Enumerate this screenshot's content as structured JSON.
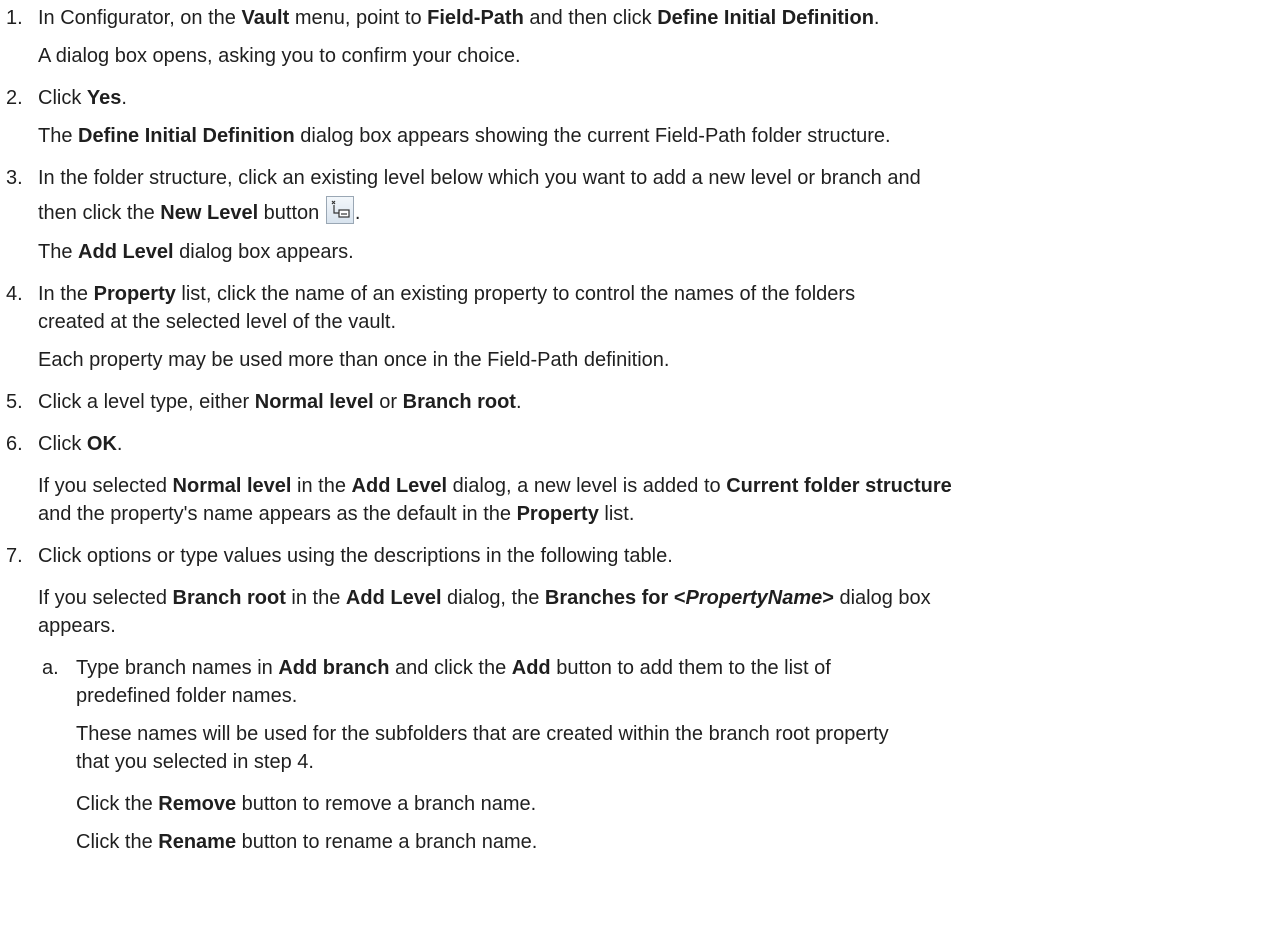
{
  "steps": [
    {
      "n": "1.",
      "parts": [
        [
          "In Configurator, on the ",
          false
        ],
        [
          "Vault",
          true
        ],
        [
          " menu, point to ",
          false
        ],
        [
          "Field-Path",
          true
        ],
        [
          " and then click ",
          false
        ],
        [
          "Define Initial Definition",
          true
        ],
        [
          ".",
          false
        ]
      ]
    },
    {
      "parts": [
        [
          "A dialog box opens, asking you to confirm your choice.",
          false
        ]
      ]
    },
    {
      "n": "2.",
      "parts": [
        [
          "Click ",
          false
        ],
        [
          "Yes",
          true
        ],
        [
          ".",
          false
        ]
      ]
    },
    {
      "parts": [
        [
          "The ",
          false
        ],
        [
          "Define Initial Definition",
          true
        ],
        [
          " dialog box appears showing the current Field-Path folder structure.",
          false
        ]
      ]
    },
    {
      "n": "3.",
      "parts": [
        [
          "In the folder structure, click an existing level below which you want to add a new level or branch and",
          false
        ]
      ]
    },
    {
      "parts": [
        [
          "then click the ",
          false
        ],
        [
          "New Level",
          true
        ],
        [
          " button ",
          false
        ]
      ],
      "icon": "new-level-icon",
      "after": "."
    },
    {
      "parts": [
        [
          "The ",
          false
        ],
        [
          "Add Level",
          true
        ],
        [
          " dialog box appears.",
          false
        ]
      ]
    },
    {
      "n": "4.",
      "parts": [
        [
          "In the ",
          false
        ],
        [
          "Property",
          true
        ],
        [
          " list, click the name of an existing property to control the names of the folders",
          false
        ]
      ]
    },
    {
      "parts": [
        [
          "created at the selected level of the vault.",
          false
        ]
      ]
    },
    {
      "parts": [
        [
          "Each property may be used more than once in the Field-Path definition.",
          false
        ]
      ]
    },
    {
      "n": "5.",
      "parts": [
        [
          "Click a level type, either ",
          false
        ],
        [
          "Normal level",
          true
        ],
        [
          " or ",
          false
        ],
        [
          "Branch root",
          true
        ],
        [
          ".",
          false
        ]
      ]
    },
    {
      "n": "6.",
      "parts": [
        [
          "Click ",
          false
        ],
        [
          "OK",
          true
        ],
        [
          ".",
          false
        ]
      ]
    },
    {
      "parts": [
        [
          "If you selected ",
          false
        ],
        [
          "Normal level",
          true
        ],
        [
          " in the ",
          false
        ],
        [
          "Add Level",
          true
        ],
        [
          " dialog, a new level is added to ",
          false
        ],
        [
          "Current folder structure",
          true
        ]
      ]
    },
    {
      "parts": [
        [
          "and the property's name appears as the default in the ",
          false
        ],
        [
          "Property",
          true
        ],
        [
          " list.",
          false
        ]
      ]
    },
    {
      "n": "7.",
      "parts": [
        [
          "Click options or type values using the descriptions in the following table.",
          false
        ]
      ]
    },
    {
      "parts": [
        [
          "If you selected ",
          false
        ],
        [
          "Branch root",
          true
        ],
        [
          " in the ",
          false
        ],
        [
          "Add Level",
          true
        ],
        [
          " dialog, the ",
          false
        ],
        [
          "Branches for <",
          true
        ],
        [
          "PropertyName",
          "bi"
        ],
        [
          ">",
          true
        ],
        [
          " dialog box",
          false
        ]
      ]
    },
    {
      "parts": [
        [
          "appears.",
          false
        ]
      ]
    },
    {
      "n": "a.",
      "sub": true,
      "parts": [
        [
          "Type branch names in ",
          false
        ],
        [
          "Add branch",
          true
        ],
        [
          " and click the ",
          false
        ],
        [
          "Add",
          true
        ],
        [
          " button to add them to the list of",
          false
        ]
      ]
    },
    {
      "sub": true,
      "parts": [
        [
          "predefined folder names.",
          false
        ]
      ]
    },
    {
      "sub": true,
      "parts": [
        [
          "These names will be used for the subfolders that are created within the branch root property",
          false
        ]
      ]
    },
    {
      "sub": true,
      "parts": [
        [
          "that you selected in step 4.",
          false
        ]
      ]
    },
    {
      "sub": true,
      "parts": [
        [
          "Click the ",
          false
        ],
        [
          "Remove",
          true
        ],
        [
          " button to remove a branch name.",
          false
        ]
      ]
    },
    {
      "sub": true,
      "parts": [
        [
          "Click the ",
          false
        ],
        [
          "Rename",
          true
        ],
        [
          " button to rename a branch name.",
          false
        ]
      ]
    }
  ]
}
